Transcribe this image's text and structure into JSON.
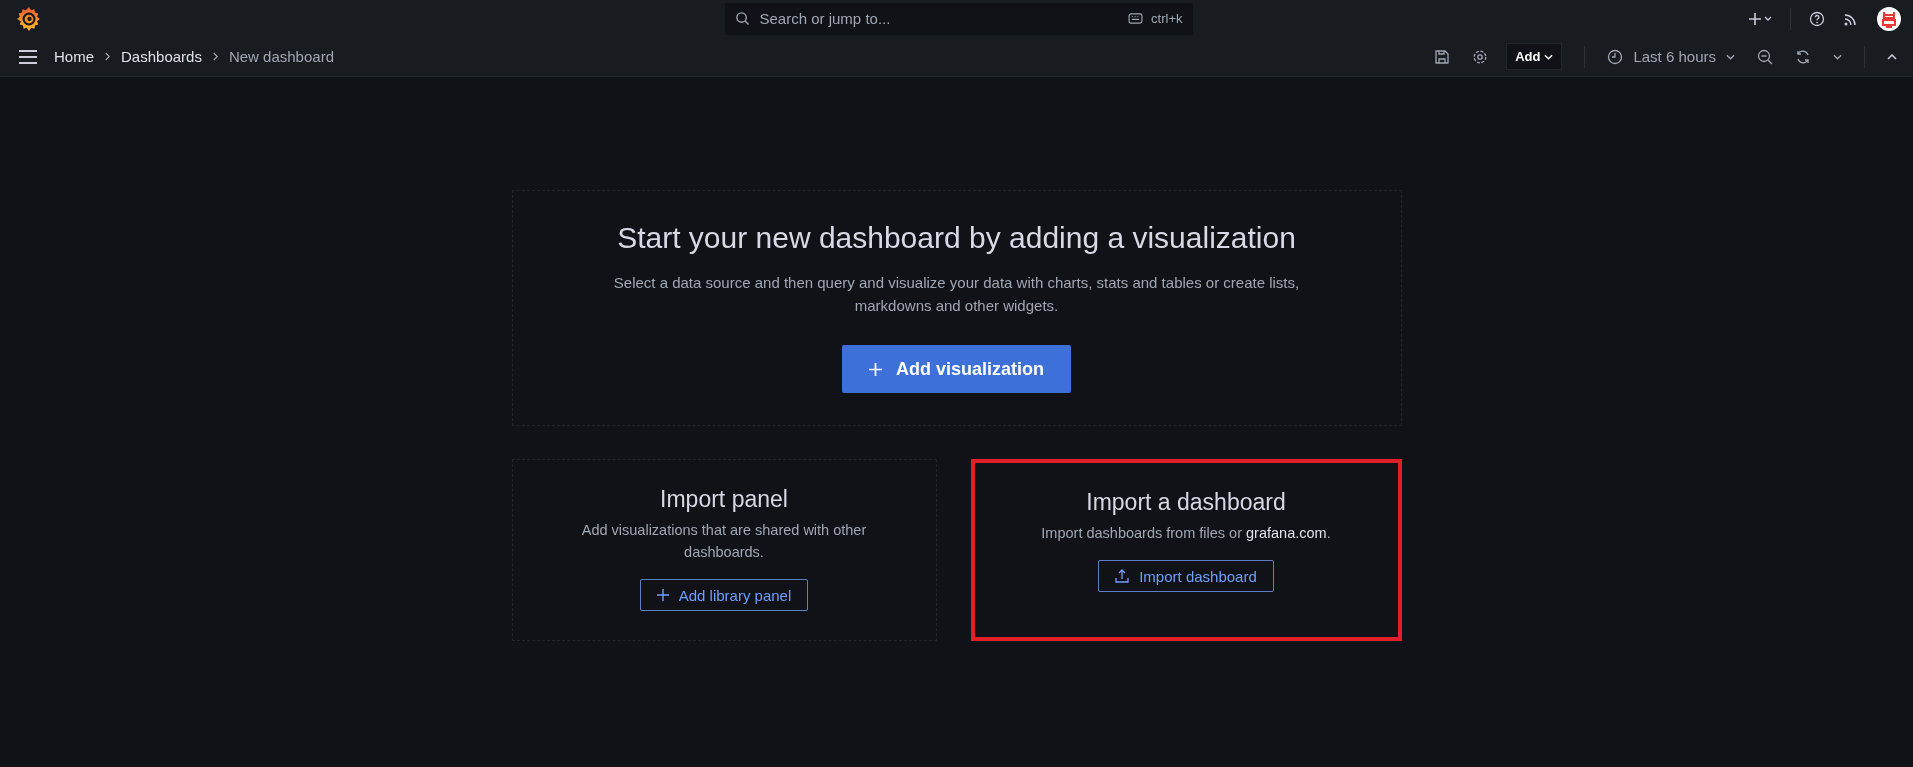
{
  "search": {
    "placeholder": "Search or jump to...",
    "shortcut": "ctrl+k"
  },
  "breadcrumbs": [
    {
      "label": "Home",
      "current": false
    },
    {
      "label": "Dashboards",
      "current": false
    },
    {
      "label": "New dashboard",
      "current": true
    }
  ],
  "toolbar": {
    "add_label": "Add",
    "time_range": "Last 6 hours"
  },
  "hero": {
    "title": "Start your new dashboard by adding a visualization",
    "description": "Select a data source and then query and visualize your data with charts, stats and tables or create lists, markdowns and other widgets.",
    "button": "Add visualization"
  },
  "cards": [
    {
      "title": "Import panel",
      "description": "Add visualizations that are shared with other dashboards.",
      "button": "Add library panel",
      "kind": "library",
      "highlighted": false
    },
    {
      "title": "Import a dashboard",
      "description": "Import dashboards from files or **grafana.com**.",
      "button": "Import dashboard",
      "kind": "import",
      "highlighted": true
    }
  ]
}
